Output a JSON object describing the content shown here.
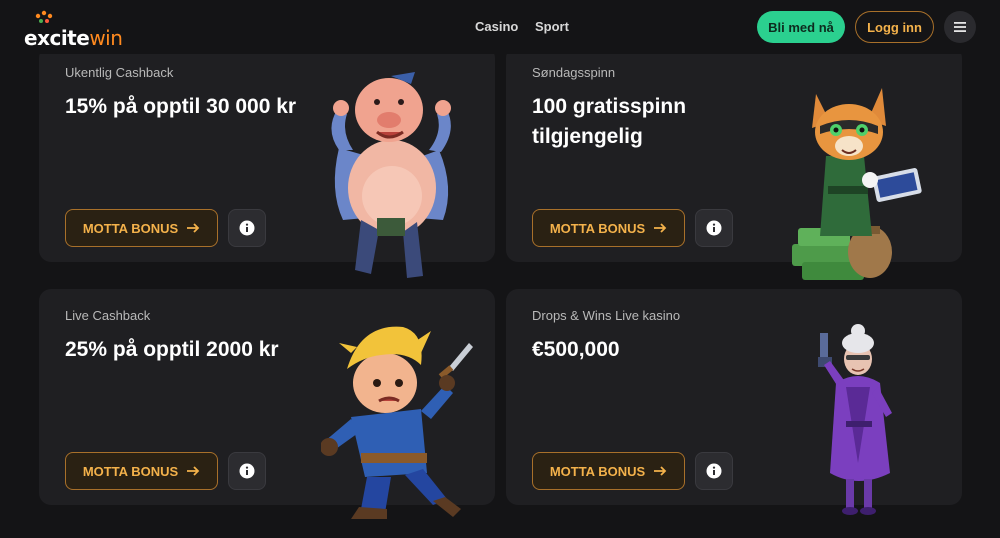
{
  "header": {
    "logo_text_a": "excite",
    "logo_text_b": "win",
    "nav": [
      "Casino",
      "Sport"
    ],
    "signup_label": "Bli med nå",
    "login_label": "Logg inn",
    "menu_icon": "hamburger-icon"
  },
  "cards": [
    {
      "label": "Ukentlig Cashback",
      "title": "15% på opptil 30 000 kr",
      "cta": "MOTTA BONUS",
      "cta_icon": "arrow-right-icon",
      "info_icon": "info-icon",
      "mascot": "pig-character"
    },
    {
      "label": "Søndagsspinn",
      "title": "100 gratisspinn tilgjengelig",
      "cta": "MOTTA BONUS",
      "cta_icon": "arrow-right-icon",
      "info_icon": "info-icon",
      "mascot": "cat-character-with-money"
    },
    {
      "label": "Live Cashback",
      "title": "25% på opptil 2000 kr",
      "cta": "MOTTA BONUS",
      "cta_icon": "arrow-right-icon",
      "info_icon": "info-icon",
      "mascot": "sword-hero-character"
    },
    {
      "label": "Drops & Wins Live kasino",
      "title": "€500,000",
      "cta": "MOTTA BONUS",
      "cta_icon": "arrow-right-icon",
      "info_icon": "info-icon",
      "mascot": "granny-character"
    }
  ],
  "colors": {
    "background": "#141416",
    "card": "#1f1f22",
    "accent_green": "#2bd08f",
    "accent_orange": "#f4b24b",
    "cta_border": "#a8702a"
  }
}
